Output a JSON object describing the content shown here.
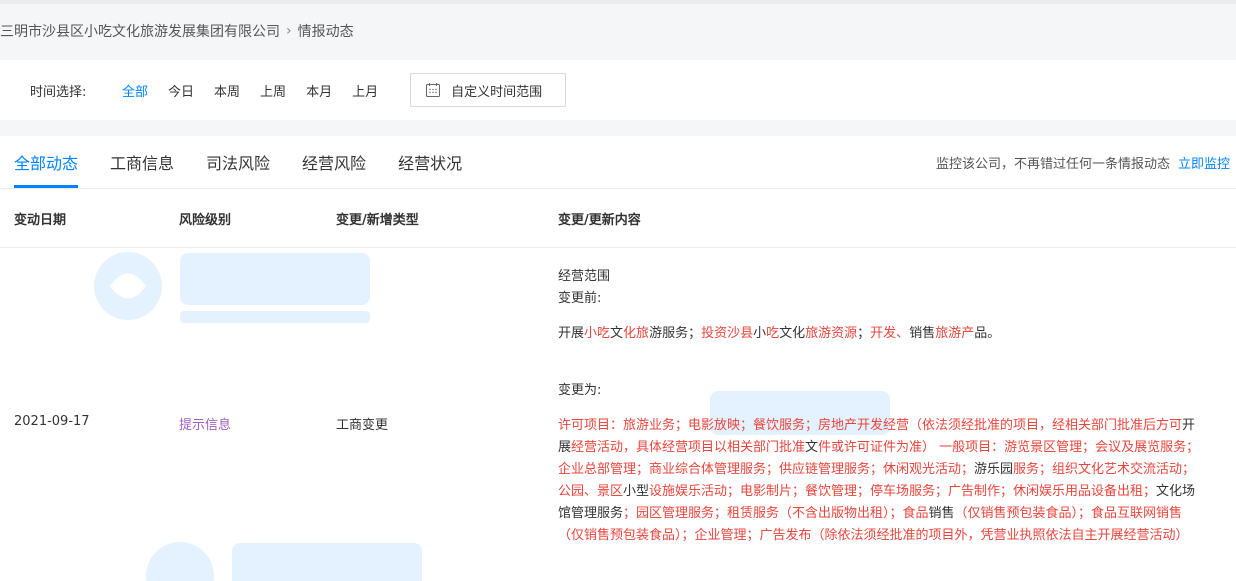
{
  "breadcrumb": {
    "company": "三明市沙县区小吃文化旅游发展集团有限公司",
    "current": "情报动态"
  },
  "time_filter": {
    "label": "时间选择:",
    "options": [
      "全部",
      "今日",
      "本周",
      "上周",
      "本月",
      "上月"
    ],
    "active": "全部",
    "custom_label": "自定义时间范围"
  },
  "tabs": {
    "items": [
      "全部动态",
      "工商信息",
      "司法风险",
      "经营风险",
      "经营状况"
    ],
    "active": "全部动态",
    "monitor_text": "监控该公司，不再错过任何一条情报动态",
    "monitor_link": "立即监控"
  },
  "table": {
    "headers": [
      "变动日期",
      "风险级别",
      "变更/新增类型",
      "变更/更新内容"
    ],
    "row": {
      "date": "2021-09-17",
      "risk": "提示信息",
      "type": "工商变更",
      "field": "经营范围",
      "before_label": "变更前:",
      "before_segments": [
        {
          "t": "开展",
          "r": false
        },
        {
          "t": "小吃",
          "r": true
        },
        {
          "t": "文",
          "r": false
        },
        {
          "t": "化旅",
          "r": true
        },
        {
          "t": "游服务；",
          "r": false
        },
        {
          "t": "投资沙县",
          "r": true
        },
        {
          "t": "小",
          "r": false
        },
        {
          "t": "吃",
          "r": true
        },
        {
          "t": "文化",
          "r": false
        },
        {
          "t": "旅游资源",
          "r": true
        },
        {
          "t": "；",
          "r": false
        },
        {
          "t": "开发、",
          "r": true
        },
        {
          "t": "销售",
          "r": false
        },
        {
          "t": "旅游产",
          "r": true
        },
        {
          "t": "品。",
          "r": false
        }
      ],
      "after_label": "变更为:",
      "after_segments": [
        {
          "t": "许可项目：旅游业务；电影放映；餐饮服务；房地产开发经营（依法须经批准的项目，经相关部门批准后方可",
          "r": true
        },
        {
          "t": "开展",
          "r": false
        },
        {
          "t": "经营活动，具体经营项目以相关部门批准",
          "r": true
        },
        {
          "t": "文",
          "r": false
        },
        {
          "t": "件或许可证件为准） 一般项目：游览景区管理；会议及展览服务；企业总部管理；商业综合体管理服务；供应链管理服务；休闲观光活动；",
          "r": true
        },
        {
          "t": "游乐园",
          "r": false
        },
        {
          "t": "服务；组织文化艺术交流活动；公园、景区",
          "r": true
        },
        {
          "t": "小型",
          "r": false
        },
        {
          "t": "设施娱乐活动；电影制片；餐饮管理；停车场服务；广告制作；休闲娱乐用品设备出租；",
          "r": true
        },
        {
          "t": "文化场馆管理服务",
          "r": false
        },
        {
          "t": "；园区管理服务；租赁服务（不含出版物出租）；食品",
          "r": true
        },
        {
          "t": "销售",
          "r": false
        },
        {
          "t": "（仅销售预包装食品）；食品互联网销售（仅销售预包装食品）；企业管理；广告发布（除依法须经批准的项目外，凭营业执照依法自主开展经营活动）",
          "r": true
        }
      ]
    }
  },
  "colors": {
    "accent": "#0084ff",
    "risk": "#9b5fc0",
    "change": "#e8453c"
  }
}
